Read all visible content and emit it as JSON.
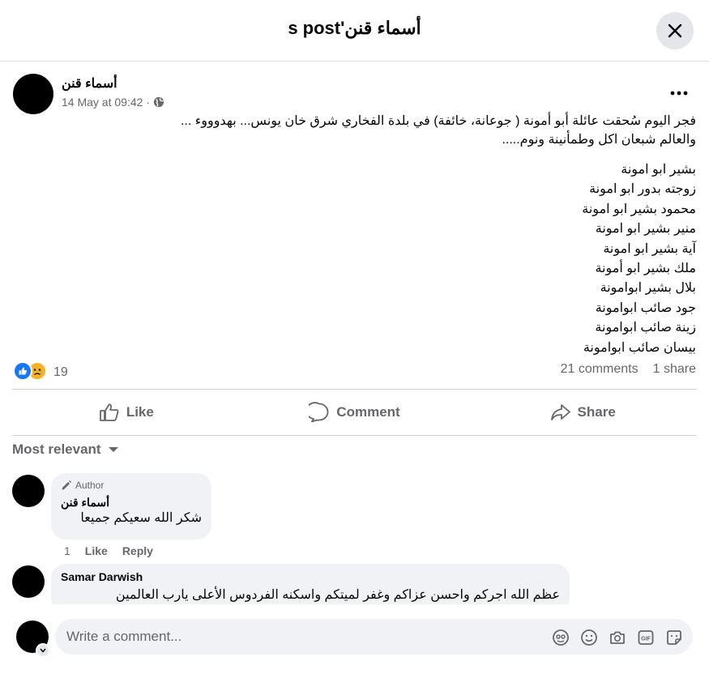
{
  "header": {
    "title": "أسماء قنن's post"
  },
  "post": {
    "author": "أسماء قنن",
    "timestamp": "14 May at 09:42",
    "separator": "·",
    "intro_line1": "فجر اليوم سُحقت عائلة أبو أمونة ( جوعانة، خائفة) في بلدة الفخاري شرق خان يونس... بهدوووء ...",
    "intro_line2": "والعالم شبعان اكل وطمأنينة ونوم.....",
    "names": [
      "بشير ابو امونة",
      "زوجته بدور ابو امونة",
      "محمود بشير ابو امونة",
      " منير بشير ابو امونة",
      " آية بشير ابو امونة",
      "ملك بشير ابو أمونة",
      "بلال بشير ابوامونة",
      "جود صائب ابوامونة",
      "زينة صائب ابوامونة",
      "بيسان صائب ابوامونة"
    ],
    "reaction_count": "19",
    "comments_count": "21 comments",
    "shares_count": "1 share"
  },
  "actions": {
    "like": "Like",
    "comment": "Comment",
    "share": "Share"
  },
  "sort": {
    "label": "Most relevant"
  },
  "comments": [
    {
      "badge": "Author",
      "name": "أسماء قنن",
      "text": "شكر الله سعيكم جميعا",
      "reaction_count": "1",
      "like": "Like",
      "reply": "Reply"
    },
    {
      "name": "Samar Darwish",
      "text": "عظم الله اجركم واحسن عزاكم وغفر لميتكم واسكنه الفردوس الأعلى يارب العالمين"
    }
  ],
  "composer": {
    "placeholder": "Write a comment..."
  },
  "icons": {
    "close": "close-icon",
    "more": "more-icon",
    "privacy": "globe-icon",
    "like": "thumbs-up-icon",
    "comment": "comment-icon",
    "share": "share-icon",
    "sort": "caret-down-icon",
    "author_badge": "pencil-icon",
    "avatar_tools": [
      "avatar-icon",
      "emoji-icon",
      "camera-icon",
      "gif-icon",
      "sticker-icon"
    ]
  },
  "colors": {
    "accent": "#1877f2",
    "muted": "#65676b",
    "bubble": "#f0f2f5"
  }
}
